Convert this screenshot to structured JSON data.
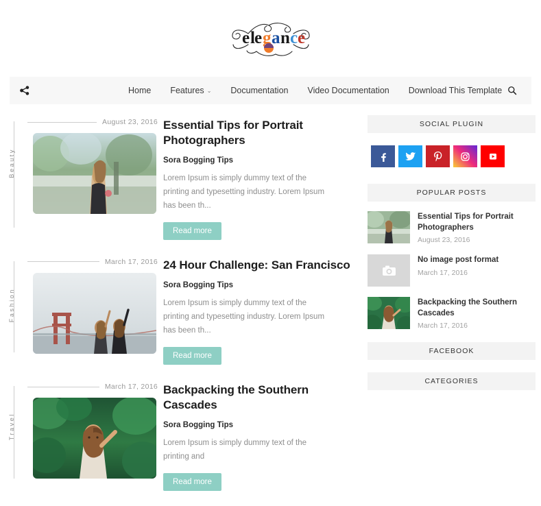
{
  "site": {
    "logo_text": "elegance"
  },
  "nav": {
    "share_icon": "share-icon",
    "search_icon": "search-icon",
    "items": [
      {
        "label": "Home",
        "has_dropdown": false
      },
      {
        "label": "Features",
        "has_dropdown": true,
        "chevron": "⌄"
      },
      {
        "label": "Documentation",
        "has_dropdown": false
      },
      {
        "label": "Video Documentation",
        "has_dropdown": false
      },
      {
        "label": "Download This Template",
        "has_dropdown": false
      }
    ]
  },
  "posts": [
    {
      "category": "Beauty",
      "date": "August 23, 2016",
      "title": "Essential Tips for Portrait Photographers",
      "author": "Sora Bogging Tips",
      "excerpt": "Lorem Ipsum is simply dummy text of the printing and typesetting industry. Lorem Ipsum has been th...",
      "read_more": "Read more",
      "image": "woman-in-garden"
    },
    {
      "category": "Fashion",
      "date": "March 17, 2016",
      "title": "24 Hour Challenge: San Francisco",
      "author": "Sora Bogging Tips",
      "excerpt": "Lorem Ipsum is simply dummy text of the printing and typesetting industry. Lorem Ipsum has been th...",
      "read_more": "Read more",
      "image": "golden-gate-bridge"
    },
    {
      "category": "Travel",
      "date": "March 17, 2016",
      "title": "Backpacking the Southern Cascades",
      "author": "Sora Bogging Tips",
      "excerpt": "Lorem Ipsum is simply dummy text of the printing and",
      "read_more": "Read more",
      "image": "woman-in-forest"
    }
  ],
  "sidebar": {
    "social": {
      "title": "SOCIAL PLUGIN",
      "buttons": [
        {
          "name": "facebook",
          "color": "#3b5998"
        },
        {
          "name": "twitter",
          "color": "#1da1f2"
        },
        {
          "name": "pinterest",
          "color": "#c92228"
        },
        {
          "name": "instagram",
          "color": "#d6249f"
        },
        {
          "name": "youtube",
          "color": "#ff0000"
        }
      ]
    },
    "popular": {
      "title": "POPULAR POSTS",
      "items": [
        {
          "title": "Essential Tips for Portrait Photographers",
          "date": "August 23, 2016",
          "image": "woman-in-garden"
        },
        {
          "title": "No image post format",
          "date": "March 17, 2016",
          "image": "no-image-placeholder"
        },
        {
          "title": "Backpacking the Southern Cascades",
          "date": "March 17, 2016",
          "image": "woman-in-forest"
        }
      ]
    },
    "facebook": {
      "title": "FACEBOOK"
    },
    "categories": {
      "title": "CATEGORIES"
    }
  },
  "colors": {
    "accent": "#8ecfc4",
    "navbar_bg": "#f7f7f7",
    "widget_head_bg": "#f3f3f3"
  }
}
